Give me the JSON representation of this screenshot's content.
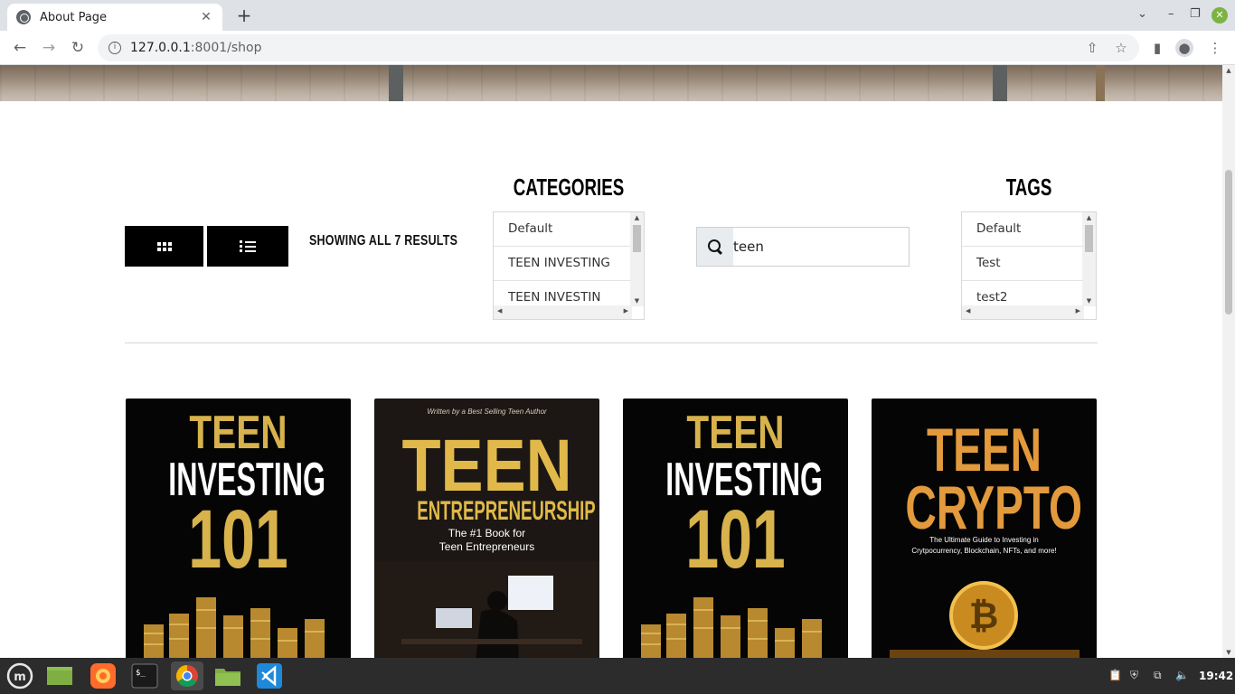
{
  "browser": {
    "tab_title": "About Page",
    "url_host": "127.0.0.1",
    "url_path": ":8001/shop"
  },
  "shop": {
    "results_text": "SHOWING ALL 7 RESULTS",
    "categories_title": "CATEGORIES",
    "categories": [
      "Default",
      "TEEN INVESTING",
      "TEEN INVESTIN"
    ],
    "search_value": "teen",
    "tags_title": "TAGS",
    "tags": [
      "Default",
      "Test",
      "test2"
    ]
  },
  "products": [
    {
      "line1": "TEEN",
      "line2": "INVESTING",
      "line3": "101"
    },
    {
      "byline": "Written by a Best Selling Teen Author",
      "line1": "TEEN",
      "line2": "ENTREPRENEURSHIP",
      "subtitle1": "The #1 Book for",
      "subtitle2": "Teen Entrepreneurs"
    },
    {
      "line1": "TEEN",
      "line2": "INVESTING",
      "line3": "101"
    },
    {
      "line1": "TEEN",
      "line2": "CRYPTO",
      "subtitle1": "The Ultimate Guide to Investing in",
      "subtitle2": "Crytpocurrency, Blockchain, NFTs, and more!"
    }
  ],
  "taskbar": {
    "clock": "19:42"
  },
  "colors": {
    "gold": "#d7b24d",
    "orange": "#e29a3c",
    "taskbar": "#2c2c2c"
  }
}
